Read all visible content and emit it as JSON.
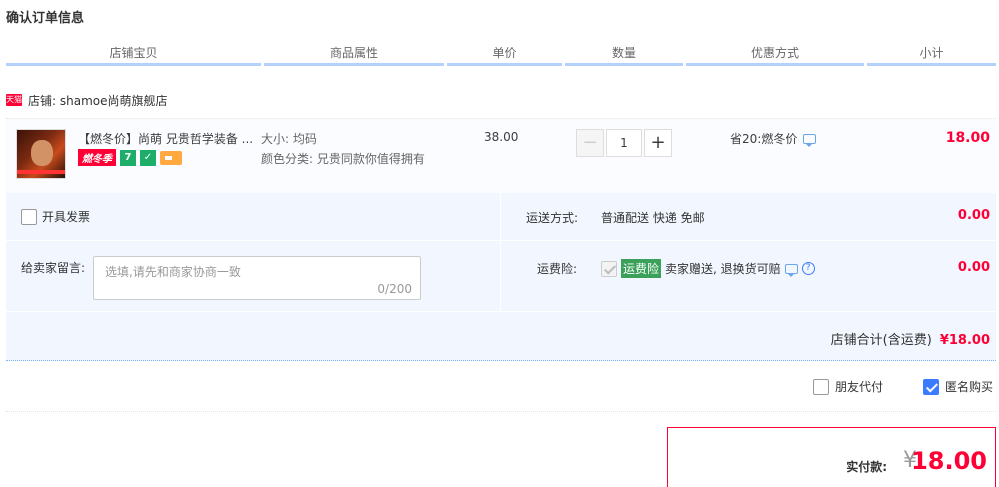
{
  "page_title": "确认订单信息",
  "columns": [
    "店铺宝贝",
    "商品属性",
    "单价",
    "数量",
    "优惠方式",
    "小计"
  ],
  "shop": {
    "platform_icon": "天猫",
    "label": "店铺: shamoe尚萌旗舰店"
  },
  "item": {
    "name": "【燃冬价】尚萌 兄贵哲学装备 ...",
    "badges": {
      "sale": "燃冬季",
      "seven": "7"
    },
    "attr_size": "大小: 均码",
    "attr_color": "颜色分类: 兄贵同款你值得拥有",
    "unit_price": "38.00",
    "quantity": "1",
    "minus": "−",
    "plus": "+",
    "promo": "省20:燃冬价",
    "subtotal": "18.00"
  },
  "invoice": {
    "label": "开具发票",
    "checked": false
  },
  "delivery": {
    "label": "运送方式:",
    "value": "普通配送 快递 免邮",
    "price": "0.00"
  },
  "message": {
    "label": "给卖家留言:",
    "placeholder": "选填,请先和商家协商一致",
    "counter": "0/200"
  },
  "insurance": {
    "label": "运费险:",
    "badge": "运费险",
    "text": "卖家赠送, 退换货可赔",
    "help": "?",
    "price": "0.00"
  },
  "shop_total": {
    "label": "店铺合计(含运费)",
    "amount": "¥18.00"
  },
  "options": {
    "friend_pay": {
      "label": "朋友代付",
      "checked": false
    },
    "anonymous": {
      "label": "匿名购买",
      "checked": true
    }
  },
  "payment": {
    "label": "实付款:",
    "currency": "¥",
    "amount": "18.00"
  },
  "colors": {
    "accent_red": "#ff0036",
    "header_line": "#b2d1ff",
    "panel_bg": "#f2f7ff",
    "check_blue": "#3a7cff",
    "insurance_green": "#3aa05a"
  },
  "icons": [
    "tmall-icon",
    "chat-icon",
    "help-icon"
  ]
}
